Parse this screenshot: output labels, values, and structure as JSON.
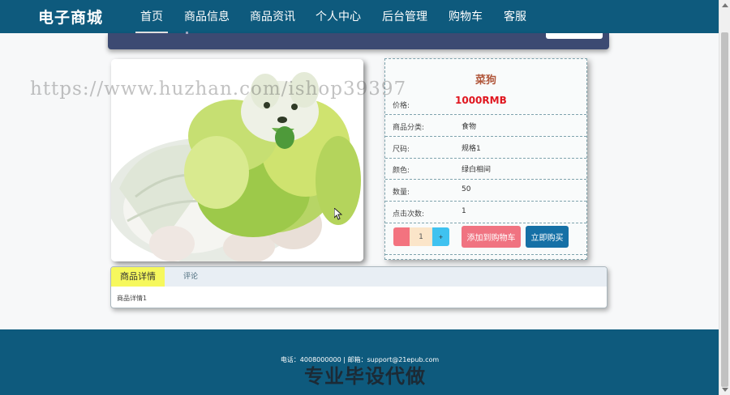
{
  "nav": {
    "brand": "电子商城",
    "items": [
      {
        "label": "首页",
        "active": true
      },
      {
        "label": "商品信息",
        "active": false
      },
      {
        "label": "商品资讯",
        "active": false
      },
      {
        "label": "个人中心",
        "active": false
      },
      {
        "label": "后台管理",
        "active": false
      },
      {
        "label": "购物车",
        "active": false
      },
      {
        "label": "客服",
        "active": false
      }
    ]
  },
  "product": {
    "image_icon": "cabbage-dog-image",
    "name": "菜狗",
    "rows": [
      {
        "label": "价格:",
        "value": "1000RMB"
      },
      {
        "label": "商品分类:",
        "value": "食物"
      },
      {
        "label": "尺码:",
        "value": "规格1"
      },
      {
        "label": "颜色:",
        "value": "绿白相间"
      },
      {
        "label": "数量:",
        "value": "50"
      },
      {
        "label": "点击次数:",
        "value": "1"
      }
    ],
    "quantity": "1",
    "minus_label": "",
    "plus_label": "+",
    "add_to_cart_label": "添加到购物车",
    "buy_now_label": "立即购买"
  },
  "detail": {
    "tabs": [
      "商品详情",
      "评论"
    ],
    "active_tab": "商品详情",
    "content": "商品详情1"
  },
  "footer": {
    "contact": "电话：4008000000 | 邮箱：support@21epub.com"
  },
  "overlay": {
    "caption": "专业毕设代做",
    "watermark": "https://www.huzhan.com/ishop39397"
  },
  "colors": {
    "nav_bg": "#0e5a7d",
    "price": "#e0161f",
    "product_name": "#b0563a",
    "add_to_cart": "#f07381",
    "buy_now": "#1570a6",
    "active_tab": "#f6f85d"
  }
}
